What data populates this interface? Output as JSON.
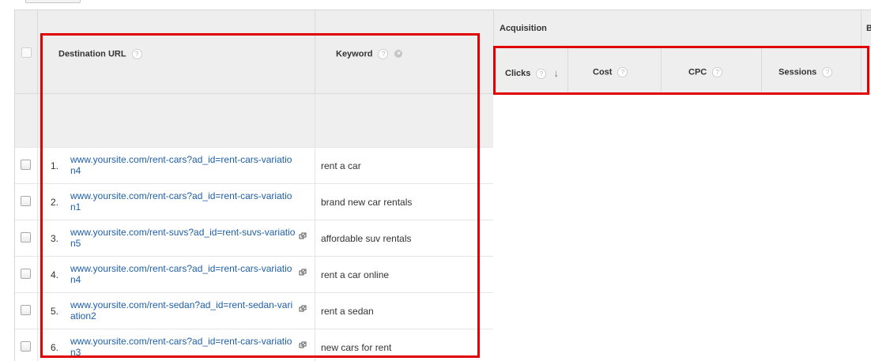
{
  "colors": {
    "highlight_red": "#e00000",
    "link_blue": "#1f5fa8",
    "header_gray": "#eeeeee"
  },
  "table": {
    "headers": {
      "destination_url": "Destination URL",
      "keyword": "Keyword",
      "acquisition_group": "Acquisition",
      "behavior_group_partial": "Be",
      "clicks": "Clicks",
      "cost": "Cost",
      "cpc": "CPC",
      "sessions": "Sessions"
    },
    "icons": {
      "help": "?",
      "clear": "×",
      "sort_desc": "↓"
    },
    "rows": [
      {
        "index": "1.",
        "url": "www.yoursite.com/rent-cars?ad_id=rent-cars-variation4",
        "keyword": "rent a car",
        "external_link": false
      },
      {
        "index": "2.",
        "url": "www.yoursite.com/rent-cars?ad_id=rent-cars-variation1",
        "keyword": "brand new car rentals",
        "external_link": false
      },
      {
        "index": "3.",
        "url": "www.yoursite.com/rent-suvs?ad_id=rent-suvs-variation5",
        "keyword": "affordable suv rentals",
        "external_link": true
      },
      {
        "index": "4.",
        "url": "www.yoursite.com/rent-cars?ad_id=rent-cars-variation4",
        "keyword": "rent a car online",
        "external_link": true
      },
      {
        "index": "5.",
        "url": "www.yoursite.com/rent-sedan?ad_id=rent-sedan-variation2",
        "keyword": "rent a sedan",
        "external_link": true
      },
      {
        "index": "6.",
        "url": "www.yoursite.com/rent-cars?ad_id=rent-cars-variation3",
        "keyword": "new cars for rent",
        "external_link": true
      }
    ]
  }
}
